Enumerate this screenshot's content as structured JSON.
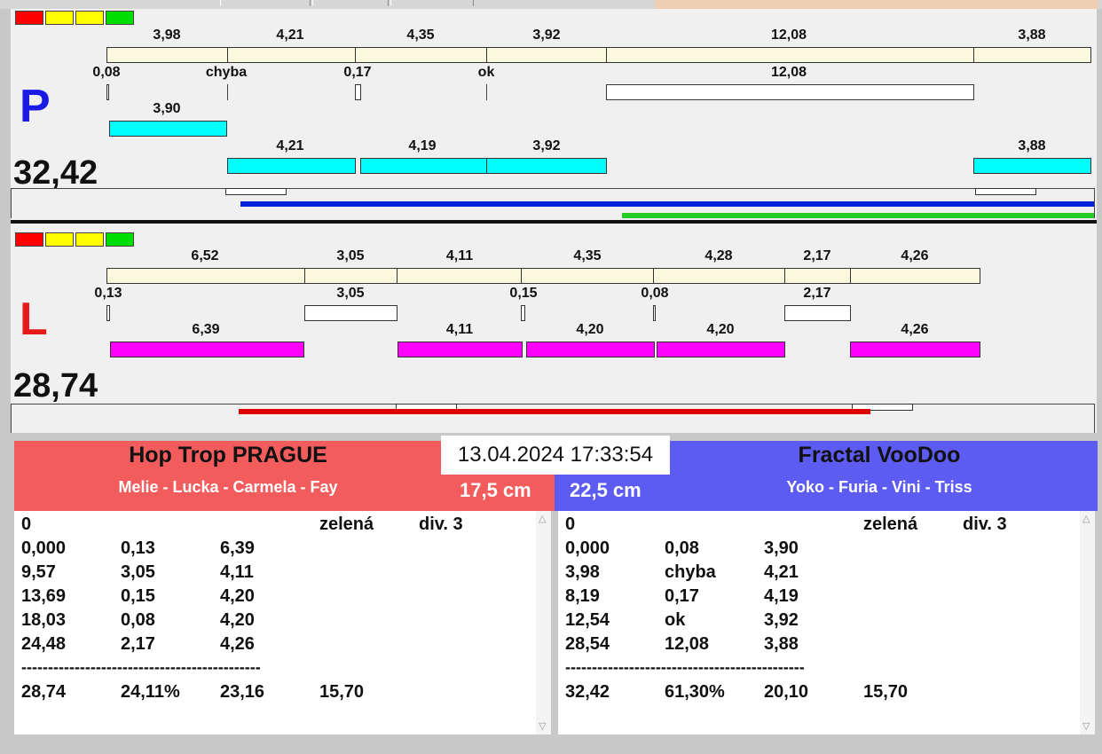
{
  "colors": {
    "segment_fill": "#fbf9dd",
    "cyan": "#00ffff",
    "magenta": "#ff00ff",
    "blue_line": "#0022dd",
    "green_line": "#22cc22",
    "red_line": "#dd0000",
    "red_header": "#f25c5c",
    "blue_header": "#5c5cf2",
    "p_letter": "#1a1ae6",
    "l_letter": "#e61a1a"
  },
  "indicator_colors": [
    "#ff0000",
    "#ffff00",
    "#ffff00",
    "#00dd00"
  ],
  "lane_p": {
    "letter": "P",
    "total": "32,42",
    "row1": [
      "3,98",
      "4,21",
      "4,35",
      "3,92",
      "12,08",
      "3,88"
    ],
    "row2": [
      "0,08",
      "chyba",
      "0,17",
      "ok",
      "12,08"
    ],
    "row3": [
      "3,90",
      "4,21",
      "4,19",
      "3,92",
      "3,88"
    ]
  },
  "lane_l": {
    "letter": "L",
    "total": "28,74",
    "row1": [
      "6,52",
      "3,05",
      "4,11",
      "4,35",
      "4,28",
      "2,17",
      "4,26"
    ],
    "row2": [
      "0,13",
      "3,05",
      "0,15",
      "0,08",
      "2,17"
    ],
    "row3": [
      "6,39",
      "4,11",
      "4,20",
      "4,20",
      "4,26"
    ]
  },
  "clock": "13.04.2024 17:33:54",
  "left_team": {
    "name": "Hop Trop PRAGUE",
    "members": "Melie - Lucka - Carmela - Fay",
    "height": "17,5 cm",
    "rows": [
      [
        "0",
        "",
        "",
        "zelená",
        "div. 3"
      ],
      [
        "0,000",
        "0,13",
        "6,39",
        "",
        ""
      ],
      [
        "9,57",
        "3,05",
        "4,11",
        "",
        ""
      ],
      [
        "13,69",
        "0,15",
        "4,20",
        "",
        ""
      ],
      [
        "18,03",
        "0,08",
        "4,20",
        "",
        ""
      ],
      [
        "24,48",
        "2,17",
        "4,26",
        "",
        ""
      ]
    ],
    "separator": "---------------------------------------------",
    "summary": [
      "28,74",
      "24,11%",
      "23,16",
      "15,70"
    ]
  },
  "right_team": {
    "name": "Fractal VooDoo",
    "members": "Yoko - Furia - Vini - Triss",
    "height": "22,5 cm",
    "rows": [
      [
        "0",
        "",
        "",
        "zelená",
        "div. 3"
      ],
      [
        "0,000",
        "0,08",
        "3,90",
        "",
        ""
      ],
      [
        "3,98",
        "chyba",
        "4,21",
        "",
        ""
      ],
      [
        "8,19",
        "0,17",
        "4,19",
        "",
        ""
      ],
      [
        "12,54",
        "ok",
        "3,92",
        "",
        ""
      ],
      [
        "28,54",
        "12,08",
        "3,88",
        "",
        ""
      ]
    ],
    "separator": "---------------------------------------------",
    "summary": [
      "32,42",
      "61,30%",
      "20,10",
      "15,70"
    ]
  }
}
